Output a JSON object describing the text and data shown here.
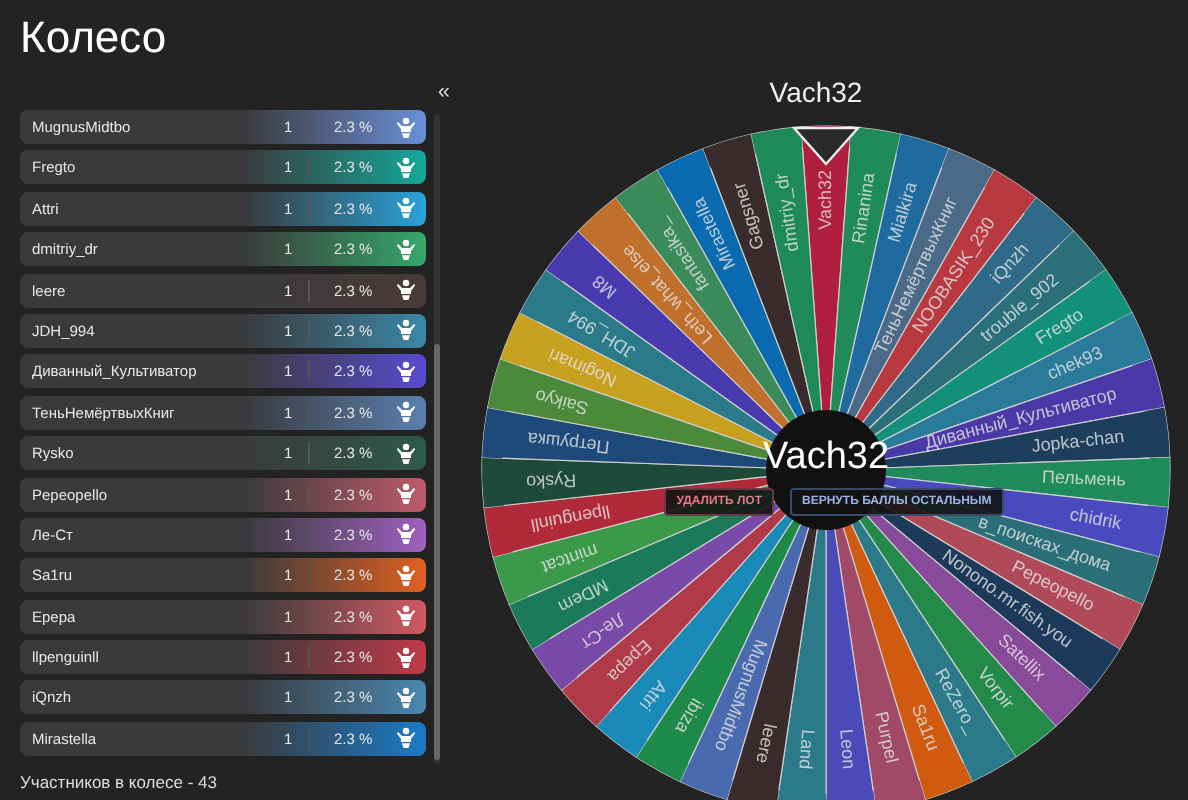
{
  "title": "Колесо",
  "collapse": "«",
  "participants": [
    {
      "name": "MugnusMidtbo",
      "points": "1",
      "chance": "2.3 %",
      "color": "#6a8fd8"
    },
    {
      "name": "Fregto",
      "points": "1",
      "chance": "2.3 %",
      "color": "#14a89a"
    },
    {
      "name": "Attri",
      "points": "1",
      "chance": "2.3 %",
      "color": "#2aa3d8"
    },
    {
      "name": "dmitriy_dr",
      "points": "1",
      "chance": "2.3 %",
      "color": "#35a86a"
    },
    {
      "name": "leere",
      "points": "1",
      "chance": "2.3 %",
      "color": "#4a3a38"
    },
    {
      "name": "JDH_994",
      "points": "1",
      "chance": "2.3 %",
      "color": "#3b88a8"
    },
    {
      "name": "Диванный_Культиватор",
      "points": "1",
      "chance": "2.3 %",
      "color": "#5a4ad0"
    },
    {
      "name": "ТеньНемёртвыхКниг",
      "points": "1",
      "chance": "2.3 %",
      "color": "#5a80b0"
    },
    {
      "name": "Rysko",
      "points": "1",
      "chance": "2.3 %",
      "color": "#2e5a48"
    },
    {
      "name": "Pepeopello",
      "points": "1",
      "chance": "2.3 %",
      "color": "#c05a6a"
    },
    {
      "name": "Ле-Ст",
      "points": "1",
      "chance": "2.3 %",
      "color": "#a060c0"
    },
    {
      "name": "Sa1ru",
      "points": "1",
      "chance": "2.3 %",
      "color": "#e06020"
    },
    {
      "name": "Epepa",
      "points": "1",
      "chance": "2.3 %",
      "color": "#d05a60"
    },
    {
      "name": "llpenguinll",
      "points": "1",
      "chance": "2.3 %",
      "color": "#c03a48"
    },
    {
      "name": "iQnzh",
      "points": "1",
      "chance": "2.3 %",
      "color": "#4a88b0"
    },
    {
      "name": "Mirastella",
      "points": "1",
      "chance": "2.3 %",
      "color": "#1a7ac8"
    }
  ],
  "footer": "Участников в колесе - 43",
  "wheel": {
    "winner": "Vach32",
    "center_label": "Vach32",
    "buttons": [
      {
        "label": "УДАЛИТЬ ЛОТ",
        "kind": "danger"
      },
      {
        "label": "ВЕРНУТЬ БАЛЛЫ ОСТАЛЬНЫМ",
        "kind": "info"
      }
    ],
    "segments": [
      {
        "name": "Vach32",
        "color": "#b0203e"
      },
      {
        "name": "Rinanina",
        "color": "#1f8a5a"
      },
      {
        "name": "Mialkira",
        "color": "#1f6a9e"
      },
      {
        "name": "ТеньНемёртвыхКниг",
        "color": "#4a6a88"
      },
      {
        "name": "NOOBASIK_230",
        "color": "#b83a40"
      },
      {
        "name": "iQnzh",
        "color": "#2f6a88"
      },
      {
        "name": "trouble_902",
        "color": "#2a6f7a"
      },
      {
        "name": "Fregto",
        "color": "#12907a"
      },
      {
        "name": "chek93",
        "color": "#2a7a9a"
      },
      {
        "name": "Диванный_Культиватор",
        "color": "#4a3aa8"
      },
      {
        "name": "Jopka-chan",
        "color": "#1e3e5e"
      },
      {
        "name": "Пельмень",
        "color": "#1f8a5a"
      },
      {
        "name": "chidrik",
        "color": "#4a4ac0"
      },
      {
        "name": "в_поисках_дома",
        "color": "#2a6e78"
      },
      {
        "name": "Pepeopello",
        "color": "#b04a58"
      },
      {
        "name": "Nonono.mr.fish.you",
        "color": "#1e3a5a"
      },
      {
        "name": "Satellix",
        "color": "#8a4a9a"
      },
      {
        "name": "Vorpir",
        "color": "#238a4a"
      },
      {
        "name": "ReZero_",
        "color": "#2a7a8a"
      },
      {
        "name": "Sa1ru",
        "color": "#d05a10"
      },
      {
        "name": "Purpel",
        "color": "#a04a68"
      },
      {
        "name": "Leon",
        "color": "#4a4ab8"
      },
      {
        "name": "Land",
        "color": "#2a7a8a"
      },
      {
        "name": "leere",
        "color": "#3a2c2c"
      },
      {
        "name": "MugnusMidtbo",
        "color": "#4a6ab0"
      },
      {
        "name": "ibiza",
        "color": "#1e8a4a"
      },
      {
        "name": "Attri",
        "color": "#1a8ab8"
      },
      {
        "name": "Epepa",
        "color": "#b03a48"
      },
      {
        "name": "Ле-Ст",
        "color": "#7a4aa8"
      },
      {
        "name": "MDem",
        "color": "#1a7a5a"
      },
      {
        "name": "mintcat",
        "color": "#3a9a4a"
      },
      {
        "name": "llpenguinll",
        "color": "#b02a3a"
      },
      {
        "name": "Rysko",
        "color": "#1e4a3a"
      },
      {
        "name": "Петрушка",
        "color": "#1e4a7a"
      },
      {
        "name": "Saikyo",
        "color": "#4a8a3a"
      },
      {
        "name": "Nogimari",
        "color": "#c8a020"
      },
      {
        "name": "JDH_994",
        "color": "#2a7a8a"
      },
      {
        "name": "M8",
        "color": "#4a3ab0"
      },
      {
        "name": "Leth_what_else",
        "color": "#c0702a"
      },
      {
        "name": "fantasika_",
        "color": "#3a8a5a"
      },
      {
        "name": "Mirastella",
        "color": "#0a6ab0"
      },
      {
        "name": "Gagsner",
        "color": "#3a2c2c"
      },
      {
        "name": "dmitriy_dr",
        "color": "#1e8a5a"
      }
    ]
  }
}
